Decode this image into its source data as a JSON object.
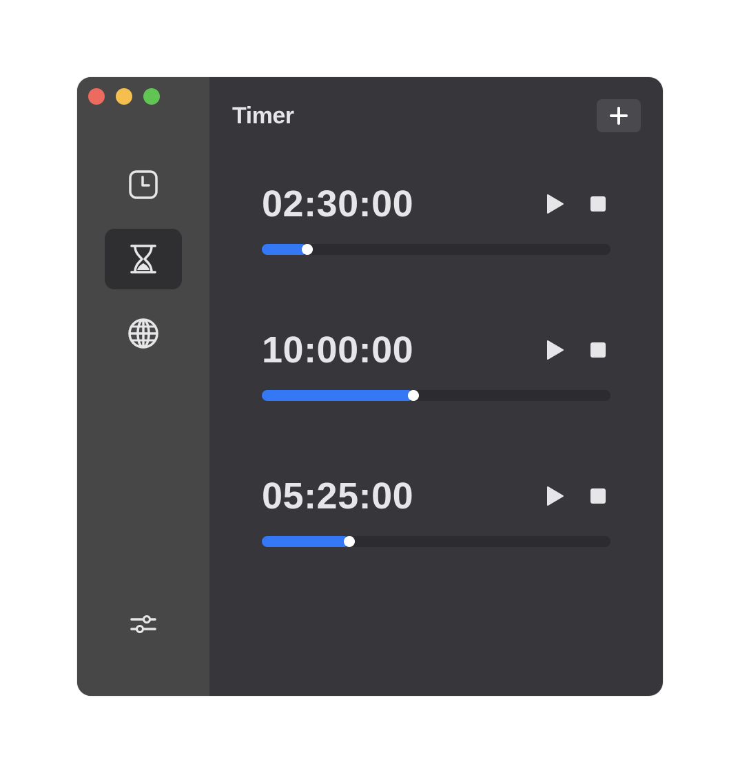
{
  "app": {
    "title": "Timer"
  },
  "sidebar": {
    "items": [
      {
        "id": "clock",
        "icon": "clock-icon",
        "active": false
      },
      {
        "id": "timer",
        "icon": "hourglass-icon",
        "active": true
      },
      {
        "id": "world-clock",
        "icon": "globe-icon",
        "active": false
      }
    ],
    "footer_icon": "sliders-icon"
  },
  "header": {
    "add_icon": "plus-icon"
  },
  "timers": [
    {
      "time": "02:30:00",
      "progress": 0.115
    },
    {
      "time": "10:00:00",
      "progress": 0.419
    },
    {
      "time": "05:25:00",
      "progress": 0.236
    }
  ],
  "colors": {
    "accent": "#3478f6",
    "sidebar_bg": "#474747",
    "main_bg": "#37363b",
    "track": "#2c2c30",
    "text": "#e6e6e8",
    "traffic_red": "#ec6a5e",
    "traffic_yellow": "#f4bf4f",
    "traffic_green": "#61c554"
  }
}
